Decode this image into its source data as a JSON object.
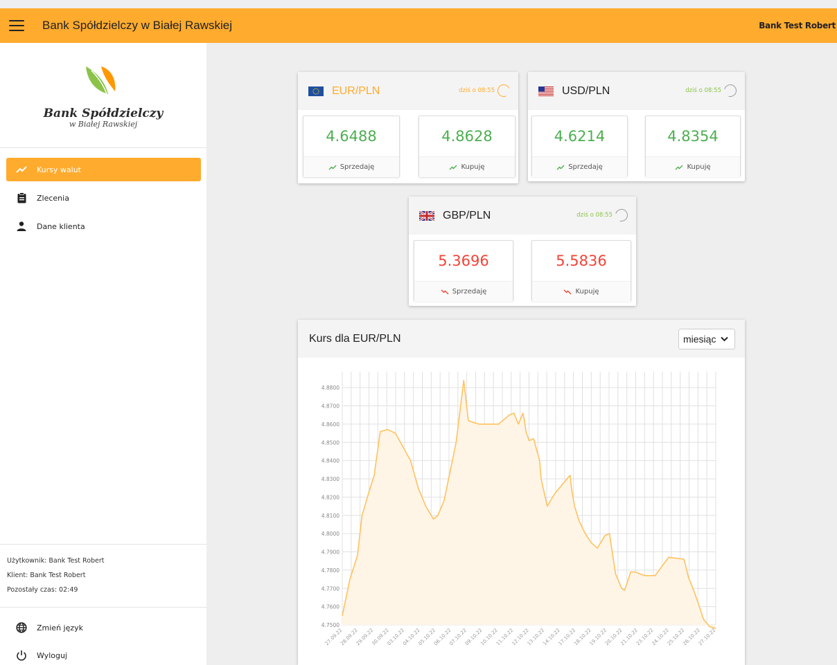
{
  "topbar": {
    "title": "Bank Spółdzielczy w Białej Rawskiej",
    "user": "Bank Test Robert"
  },
  "sidebar": {
    "logo_name": "Bank Spółdzielczy",
    "logo_sub": "w Białej Rawskiej",
    "items": [
      {
        "label": "Kursy walut",
        "icon": "trending-up-icon",
        "active": true
      },
      {
        "label": "Zlecenia",
        "icon": "clipboard-icon",
        "active": false
      },
      {
        "label": "Dane klienta",
        "icon": "person-icon",
        "active": false
      }
    ],
    "info": {
      "user": "Użytkownik: Bank Test Robert",
      "client": "Klient: Bank Test Robert",
      "time": "Pozostały czas: 02:49"
    },
    "footer": [
      {
        "label": "Zmień język",
        "icon": "globe-icon"
      },
      {
        "label": "Wyloguj",
        "icon": "power-icon"
      }
    ]
  },
  "cards": [
    {
      "pair": "EUR/PLN",
      "stamp": "dziś o 08:55",
      "flag": "eu-flag-icon",
      "sell": "4.6488",
      "buy": "4.8628",
      "trend": "up",
      "highlight": true
    },
    {
      "pair": "USD/PLN",
      "stamp": "dziś o 08:55",
      "flag": "us-flag-icon",
      "sell": "4.6214",
      "buy": "4.8354",
      "trend": "up",
      "highlight": false
    },
    {
      "pair": "GBP/PLN",
      "stamp": "dziś o 08:55",
      "flag": "uk-flag-icon",
      "sell": "5.3696",
      "buy": "5.5836",
      "trend": "down",
      "highlight": false
    }
  ],
  "labels": {
    "sell": "Sprzedaję",
    "buy": "Kupuję"
  },
  "colors": {
    "accent": "#ffab2e",
    "up": "#4caf50",
    "down": "#f44336",
    "line": "#ffc15e"
  },
  "chart": {
    "title": "Kurs dla EUR/PLN",
    "period": "miesiąc"
  },
  "chart_data": {
    "type": "area",
    "title": "Kurs dla EUR/PLN",
    "ylim": [
      4.75,
      4.885
    ],
    "yticks": [
      "4.7500",
      "4.7600",
      "4.7700",
      "4.7800",
      "4.7900",
      "4.8000",
      "4.8100",
      "4.8200",
      "4.8300",
      "4.8400",
      "4.8500",
      "4.8600",
      "4.8700",
      "4.8800"
    ],
    "xticks": [
      "27.09.22",
      "28.09.22",
      "29.09.22",
      "30.09.22",
      "03.10.22",
      "04.10.22",
      "05.10.22",
      "06.10.22",
      "07.10.22",
      "09.10.22",
      "10.10.22",
      "11.10.22",
      "12.10.22",
      "13.10.22",
      "14.10.22",
      "17.10.22",
      "18.10.22",
      "19.10.22",
      "20.10.22",
      "21.10.22",
      "23.10.22",
      "24.10.22",
      "25.10.22",
      "26.10.22",
      "27.10.22"
    ],
    "grid": true,
    "x": [
      0,
      0.5,
      1,
      1.3,
      1.8,
      2.1,
      2.5,
      3,
      3.5,
      4.5,
      5,
      5.5,
      6,
      6.3,
      6.7,
      7,
      7.5,
      8,
      8.3,
      8.6,
      9,
      9.3,
      9.7,
      10.3,
      11,
      11.3,
      11.6,
      11.9,
      12,
      12.1,
      12.3,
      12.6,
      13,
      13.1,
      13.5,
      14,
      15,
      15.1,
      15.3,
      15.6,
      16,
      16.4,
      16.8,
      17.3,
      17.6,
      18,
      18.4,
      18.6,
      19,
      19.3,
      19.6,
      19.9,
      20.1,
      20.6,
      21.5,
      22.5,
      22.6,
      22.8,
      23.1,
      23.4,
      23.8,
      24.2,
      24.6
    ],
    "y": [
      4.755,
      4.775,
      4.788,
      4.81,
      4.824,
      4.832,
      4.856,
      4.857,
      4.855,
      4.84,
      4.825,
      4.815,
      4.808,
      4.81,
      4.818,
      4.83,
      4.85,
      4.884,
      4.862,
      4.861,
      4.86,
      4.86,
      4.86,
      4.86,
      4.865,
      4.866,
      4.86,
      4.866,
      4.862,
      4.856,
      4.851,
      4.852,
      4.84,
      4.83,
      4.815,
      4.822,
      4.832,
      4.825,
      4.815,
      4.807,
      4.8,
      4.795,
      4.792,
      4.799,
      4.8,
      4.778,
      4.77,
      4.769,
      4.779,
      4.779,
      4.778,
      4.777,
      4.777,
      4.777,
      4.787,
      4.786,
      4.783,
      4.776,
      4.77,
      4.763,
      4.753,
      4.749,
      4.748
    ],
    "fill": "#fff5e6"
  }
}
